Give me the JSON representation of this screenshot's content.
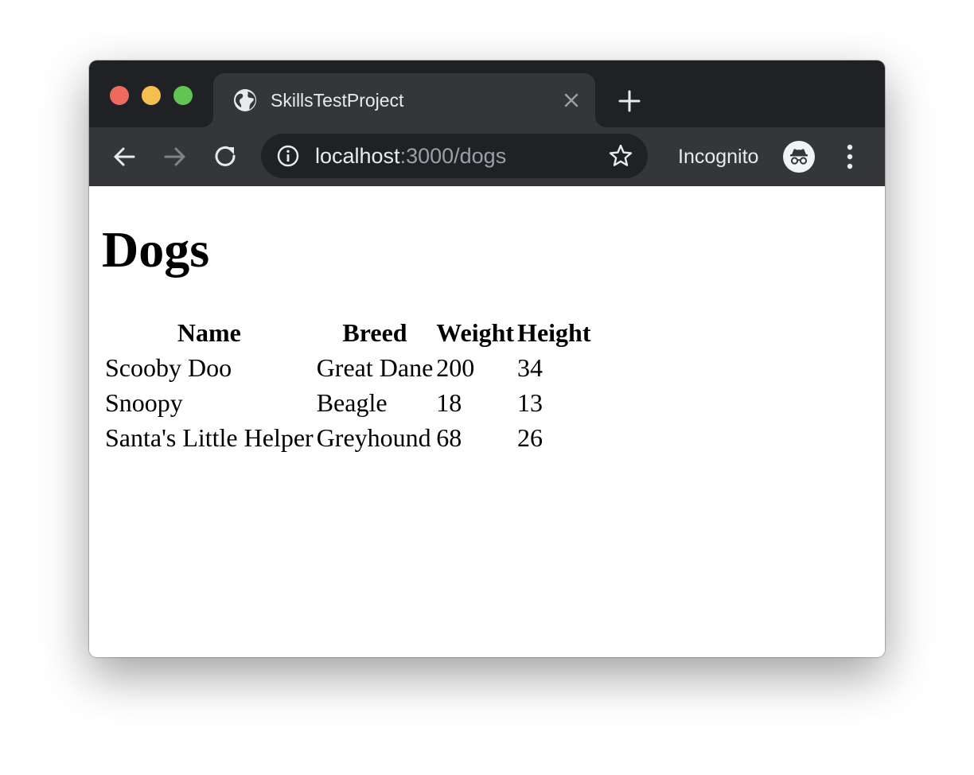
{
  "browser": {
    "tab": {
      "title": "SkillsTestProject",
      "favicon": "globe-icon"
    },
    "address_bar": {
      "host": "localhost",
      "path": ":3000/dogs"
    },
    "profile": {
      "label": "Incognito",
      "icon": "incognito-icon"
    },
    "colors": {
      "frame": "#202124",
      "toolbar": "#35363a",
      "traffic_red": "#ed6a5e",
      "traffic_yellow": "#f5bf4f",
      "traffic_green": "#61c554"
    }
  },
  "page": {
    "heading": "Dogs",
    "table": {
      "headers": [
        "Name",
        "Breed",
        "Weight",
        "Height"
      ],
      "rows": [
        [
          "Scooby Doo",
          "Great Dane",
          "200",
          "34"
        ],
        [
          "Snoopy",
          "Beagle",
          "18",
          "13"
        ],
        [
          "Santa's Little Helper",
          "Greyhound",
          "68",
          "26"
        ]
      ]
    }
  }
}
